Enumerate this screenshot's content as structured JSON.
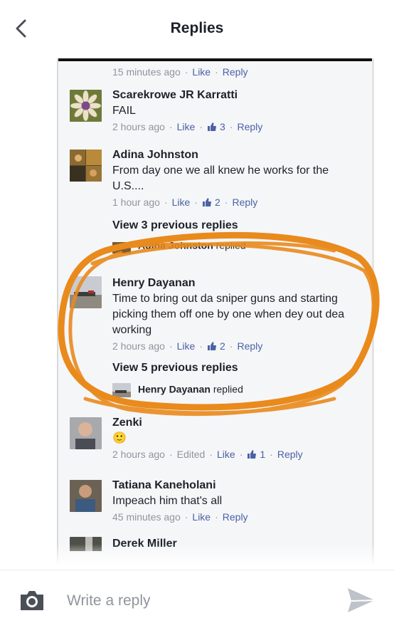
{
  "header": {
    "title": "Replies"
  },
  "top_meta": {
    "time": "15 minutes ago",
    "like": "Like",
    "reply": "Reply"
  },
  "comments": [
    {
      "name": "Scarekrowe JR Karratti",
      "text": "FAIL",
      "time": "2 hours ago",
      "like": "Like",
      "likes": "3",
      "reply": "Reply"
    },
    {
      "name": "Adina Johnston",
      "text": "From day one we all knew he works for the U.S....",
      "time": "1 hour ago",
      "like": "Like",
      "likes": "2",
      "reply": "Reply"
    },
    {
      "name": "Henry Dayanan",
      "text": "Time to bring out da sniper guns and starting picking them off one by one when dey out dea working",
      "time": "2 hours ago",
      "like": "Like",
      "likes": "2",
      "reply": "Reply"
    },
    {
      "name": "Zenki",
      "text": "🙂",
      "time": "2 hours ago",
      "edited": "Edited",
      "like": "Like",
      "likes": "1",
      "reply": "Reply"
    },
    {
      "name": "Tatiana Kaneholani",
      "text": "Impeach him that's all",
      "time": "45 minutes ago",
      "like": "Like",
      "reply": "Reply"
    },
    {
      "name": "Derek Miller"
    }
  ],
  "view_prev_1": "View 3 previous replies",
  "replied_1": {
    "name": "Adina Johnston",
    "suffix": "replied"
  },
  "view_prev_2": "View 5 previous replies",
  "replied_2": {
    "name": "Henry Dayanan",
    "suffix": "replied"
  },
  "composer": {
    "placeholder": "Write a reply"
  },
  "colors": {
    "annotation": "#e98a1c",
    "link": "#4b62a5",
    "meta": "#90949c"
  }
}
